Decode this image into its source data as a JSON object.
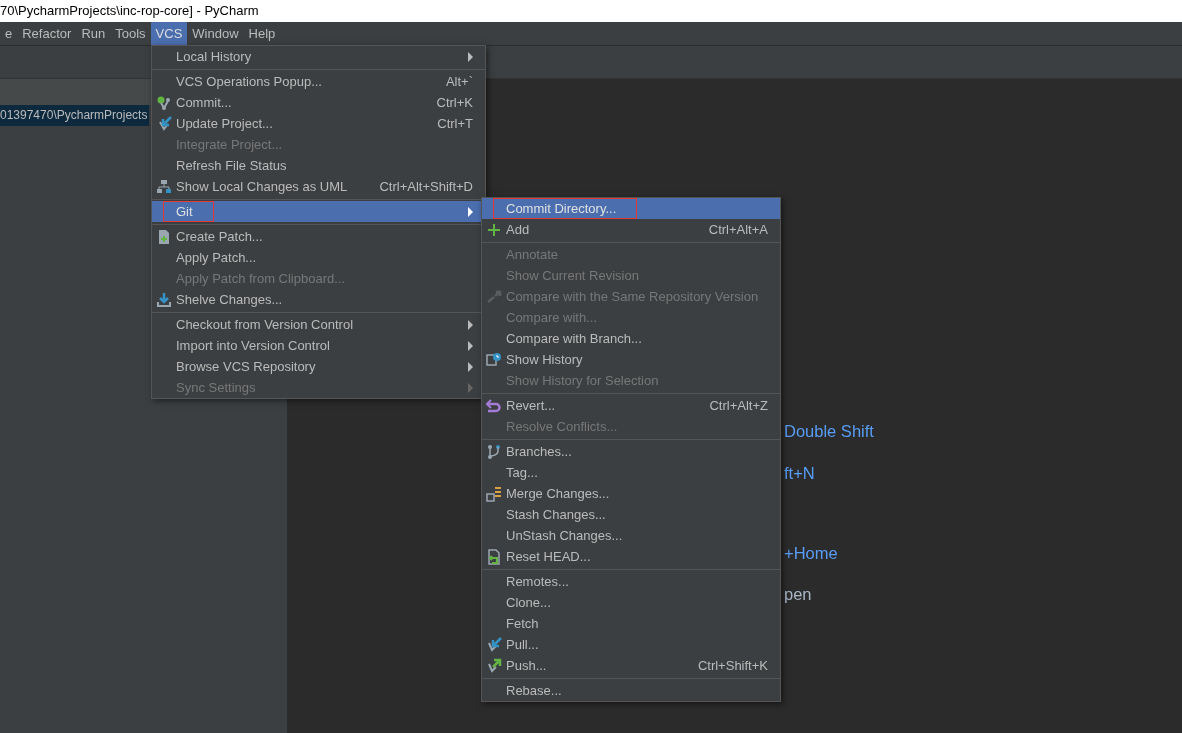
{
  "window": {
    "title": "70\\PycharmProjects\\inc-rop-core] - PyCharm"
  },
  "menu_bar": [
    {
      "label": "e",
      "selected": false
    },
    {
      "label": "Refactor",
      "selected": false
    },
    {
      "label": "Run",
      "selected": false
    },
    {
      "label": "Tools",
      "selected": false
    },
    {
      "label": "VCS",
      "selected": true
    },
    {
      "label": "Window",
      "selected": false
    },
    {
      "label": "Help",
      "selected": false
    }
  ],
  "project_panel": {
    "path": "01397470\\PycharmProjects"
  },
  "editor_hints": [
    {
      "text": "Double Shift",
      "kind": "shortcut"
    },
    {
      "text": "ft+N",
      "kind": "shortcut"
    },
    {
      "text": "+Home",
      "kind": "shortcut"
    },
    {
      "text": "pen",
      "kind": "label"
    }
  ],
  "vcs_menu": {
    "items": [
      {
        "kind": "item",
        "label": "Local History",
        "submenu": true,
        "disabled": false,
        "selected": false,
        "annotated": false
      },
      {
        "kind": "separator"
      },
      {
        "kind": "item",
        "label": "VCS Operations Popup...",
        "shortcut": "Alt+`",
        "submenu": false,
        "disabled": false,
        "selected": false,
        "annotated": false
      },
      {
        "kind": "item",
        "label": "Commit...",
        "shortcut": "Ctrl+K",
        "submenu": false,
        "disabled": false,
        "selected": false,
        "annotated": false
      },
      {
        "kind": "item",
        "label": "Update Project...",
        "shortcut": "Ctrl+T",
        "submenu": false,
        "disabled": false,
        "selected": false,
        "annotated": false
      },
      {
        "kind": "item",
        "label": "Integrate Project...",
        "submenu": false,
        "disabled": true,
        "selected": false,
        "annotated": false
      },
      {
        "kind": "item",
        "label": "Refresh File Status",
        "submenu": false,
        "disabled": false,
        "selected": false,
        "annotated": false
      },
      {
        "kind": "item",
        "label": "Show Local Changes as UML",
        "shortcut": "Ctrl+Alt+Shift+D",
        "submenu": false,
        "disabled": false,
        "selected": false,
        "annotated": false
      },
      {
        "kind": "separator"
      },
      {
        "kind": "item",
        "label": "Git",
        "submenu": true,
        "disabled": false,
        "selected": true,
        "annotated": true
      },
      {
        "kind": "separator"
      },
      {
        "kind": "item",
        "label": "Create Patch...",
        "submenu": false,
        "disabled": false,
        "selected": false,
        "annotated": false
      },
      {
        "kind": "item",
        "label": "Apply Patch...",
        "submenu": false,
        "disabled": false,
        "selected": false,
        "annotated": false
      },
      {
        "kind": "item",
        "label": "Apply Patch from Clipboard...",
        "submenu": false,
        "disabled": true,
        "selected": false,
        "annotated": false
      },
      {
        "kind": "item",
        "label": "Shelve Changes...",
        "submenu": false,
        "disabled": false,
        "selected": false,
        "annotated": false
      },
      {
        "kind": "separator"
      },
      {
        "kind": "item",
        "label": "Checkout from Version Control",
        "submenu": true,
        "disabled": false,
        "selected": false,
        "annotated": false
      },
      {
        "kind": "item",
        "label": "Import into Version Control",
        "submenu": true,
        "disabled": false,
        "selected": false,
        "annotated": false
      },
      {
        "kind": "item",
        "label": "Browse VCS Repository",
        "submenu": true,
        "disabled": false,
        "selected": false,
        "annotated": false
      },
      {
        "kind": "item",
        "label": "Sync Settings",
        "submenu": true,
        "disabled": true,
        "selected": false,
        "annotated": false
      }
    ]
  },
  "git_submenu": {
    "items": [
      {
        "kind": "item",
        "label": "Commit Directory...",
        "submenu": false,
        "disabled": false,
        "selected": true,
        "annotated": true
      },
      {
        "kind": "item",
        "label": "Add",
        "shortcut": "Ctrl+Alt+A",
        "submenu": false,
        "disabled": false,
        "selected": false,
        "annotated": false
      },
      {
        "kind": "separator"
      },
      {
        "kind": "item",
        "label": "Annotate",
        "submenu": false,
        "disabled": true,
        "selected": false,
        "annotated": false
      },
      {
        "kind": "item",
        "label": "Show Current Revision",
        "submenu": false,
        "disabled": true,
        "selected": false,
        "annotated": false
      },
      {
        "kind": "item",
        "label": "Compare with the Same Repository Version",
        "submenu": false,
        "disabled": true,
        "selected": false,
        "annotated": false
      },
      {
        "kind": "item",
        "label": "Compare with...",
        "submenu": false,
        "disabled": true,
        "selected": false,
        "annotated": false
      },
      {
        "kind": "item",
        "label": "Compare with Branch...",
        "submenu": false,
        "disabled": false,
        "selected": false,
        "annotated": false
      },
      {
        "kind": "item",
        "label": "Show History",
        "submenu": false,
        "disabled": false,
        "selected": false,
        "annotated": false
      },
      {
        "kind": "item",
        "label": "Show History for Selection",
        "submenu": false,
        "disabled": true,
        "selected": false,
        "annotated": false
      },
      {
        "kind": "separator"
      },
      {
        "kind": "item",
        "label": "Revert...",
        "shortcut": "Ctrl+Alt+Z",
        "submenu": false,
        "disabled": false,
        "selected": false,
        "annotated": false
      },
      {
        "kind": "item",
        "label": "Resolve Conflicts...",
        "submenu": false,
        "disabled": true,
        "selected": false,
        "annotated": false
      },
      {
        "kind": "separator"
      },
      {
        "kind": "item",
        "label": "Branches...",
        "submenu": false,
        "disabled": false,
        "selected": false,
        "annotated": false
      },
      {
        "kind": "item",
        "label": "Tag...",
        "submenu": false,
        "disabled": false,
        "selected": false,
        "annotated": false
      },
      {
        "kind": "item",
        "label": "Merge Changes...",
        "submenu": false,
        "disabled": false,
        "selected": false,
        "annotated": false
      },
      {
        "kind": "item",
        "label": "Stash Changes...",
        "submenu": false,
        "disabled": false,
        "selected": false,
        "annotated": false
      },
      {
        "kind": "item",
        "label": "UnStash Changes...",
        "submenu": false,
        "disabled": false,
        "selected": false,
        "annotated": false
      },
      {
        "kind": "item",
        "label": "Reset HEAD...",
        "submenu": false,
        "disabled": false,
        "selected": false,
        "annotated": false
      },
      {
        "kind": "separator"
      },
      {
        "kind": "item",
        "label": "Remotes...",
        "submenu": false,
        "disabled": false,
        "selected": false,
        "annotated": false
      },
      {
        "kind": "item",
        "label": "Clone...",
        "submenu": false,
        "disabled": false,
        "selected": false,
        "annotated": false
      },
      {
        "kind": "item",
        "label": "Fetch",
        "submenu": false,
        "disabled": false,
        "selected": false,
        "annotated": false
      },
      {
        "kind": "item",
        "label": "Pull...",
        "submenu": false,
        "disabled": false,
        "selected": false,
        "annotated": false
      },
      {
        "kind": "item",
        "label": "Push...",
        "shortcut": "Ctrl+Shift+K",
        "submenu": false,
        "disabled": false,
        "selected": false,
        "annotated": false
      },
      {
        "kind": "separator"
      },
      {
        "kind": "item",
        "label": "Rebase...",
        "submenu": false,
        "disabled": false,
        "selected": false,
        "annotated": false
      }
    ]
  }
}
